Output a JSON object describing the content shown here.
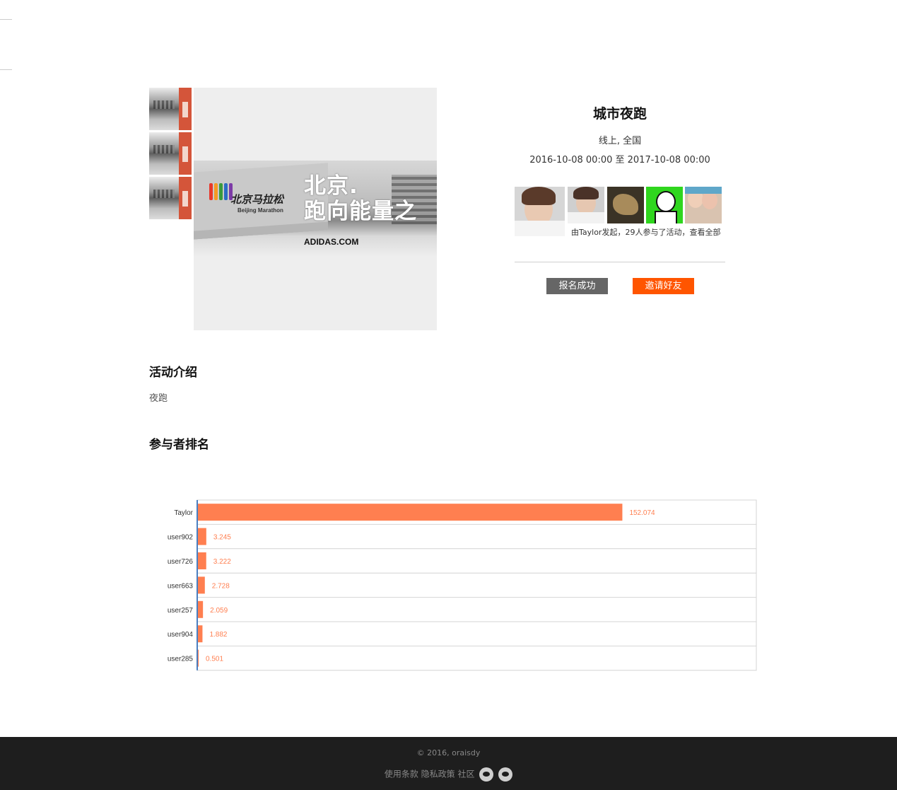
{
  "gallery": {
    "thumbnails": [
      "thumb-1",
      "thumb-2",
      "thumb-3"
    ],
    "banner": {
      "slogan_line1": "北京.",
      "slogan_line2": "跑向能量之",
      "logo_text": "北京马拉松",
      "logo_sub": "Beijing Marathon",
      "brand": "ADIDAS.COM"
    }
  },
  "event": {
    "title": "城市夜跑",
    "location": "线上, 全国",
    "date_range": "2016-10-08 00:00 至 2017-10-08 00:00",
    "participants_text": "由Taylor发起，29人参与了活动，查看全部",
    "registered_label": "报名成功",
    "invite_label": "邀请好友"
  },
  "sections": {
    "intro_title": "活动介绍",
    "intro_text": "夜跑",
    "ranking_title": "参与者排名"
  },
  "chart_data": {
    "type": "bar",
    "orientation": "horizontal",
    "categories": [
      "Taylor",
      "user902",
      "user726",
      "user663",
      "user257",
      "user904",
      "user285"
    ],
    "values": [
      152.074,
      3.245,
      3.222,
      2.728,
      2.059,
      1.882,
      0.501
    ],
    "value_labels": [
      "152.074",
      "3.245",
      "3.222",
      "2.728",
      "2.059",
      "1.882",
      "0.501"
    ],
    "xlim": [
      0,
      200
    ],
    "grid": true,
    "bar_color": "#ff7f50"
  },
  "footer": {
    "copyright": "© 2016, oraisdy",
    "terms": "使用条款",
    "privacy": "隐私政策",
    "community": "社区",
    "icons": [
      "weibo-icon",
      "wechat-icon"
    ]
  },
  "colors": {
    "accent": "#ff5500",
    "bar": "#ff7f50",
    "axis": "#4a7fc1",
    "footer_bg": "#1e1e1e"
  }
}
